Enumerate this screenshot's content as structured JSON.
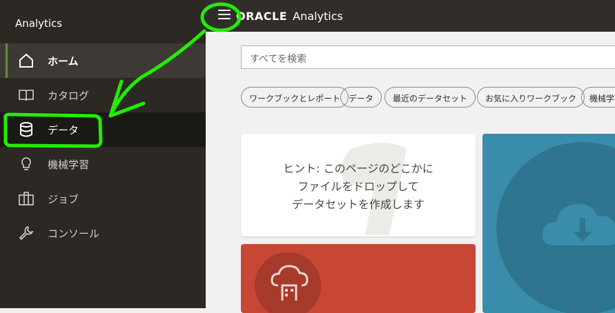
{
  "sidebar": {
    "title": "Analytics",
    "items": [
      {
        "label": "ホーム",
        "icon": "home-icon",
        "state": "active"
      },
      {
        "label": "カタログ",
        "icon": "book-icon",
        "state": "normal"
      },
      {
        "label": "データ",
        "icon": "database-icon",
        "state": "hover"
      },
      {
        "label": "機械学習",
        "icon": "lightbulb-icon",
        "state": "normal"
      },
      {
        "label": "ジョブ",
        "icon": "jobs-icon",
        "state": "normal"
      },
      {
        "label": "コンソール",
        "icon": "wrench-icon",
        "state": "normal"
      }
    ]
  },
  "header": {
    "menu_icon": "hamburger-menu-icon",
    "brand": "ORACLE",
    "product": "Analytics"
  },
  "search": {
    "placeholder": "すべてを検索"
  },
  "chips": [
    "ワークブックとレポート",
    "データ",
    "最近のデータセット",
    "お気に入りワークブック",
    "機械学"
  ],
  "cards": {
    "hint": {
      "line1": "ヒント: このページのどこかに",
      "line2": "ファイルをドロップして",
      "line3": "データセットを作成します"
    },
    "blue_icon": "cloud-download-icon",
    "red_icon": "cloud-building-icon"
  },
  "colors": {
    "sidebar_bg": "#2c2924",
    "topbar_bg": "#312d2a",
    "card_blue": "#3a8daa",
    "card_red": "#c74634",
    "annotation_green": "#22ee00"
  }
}
